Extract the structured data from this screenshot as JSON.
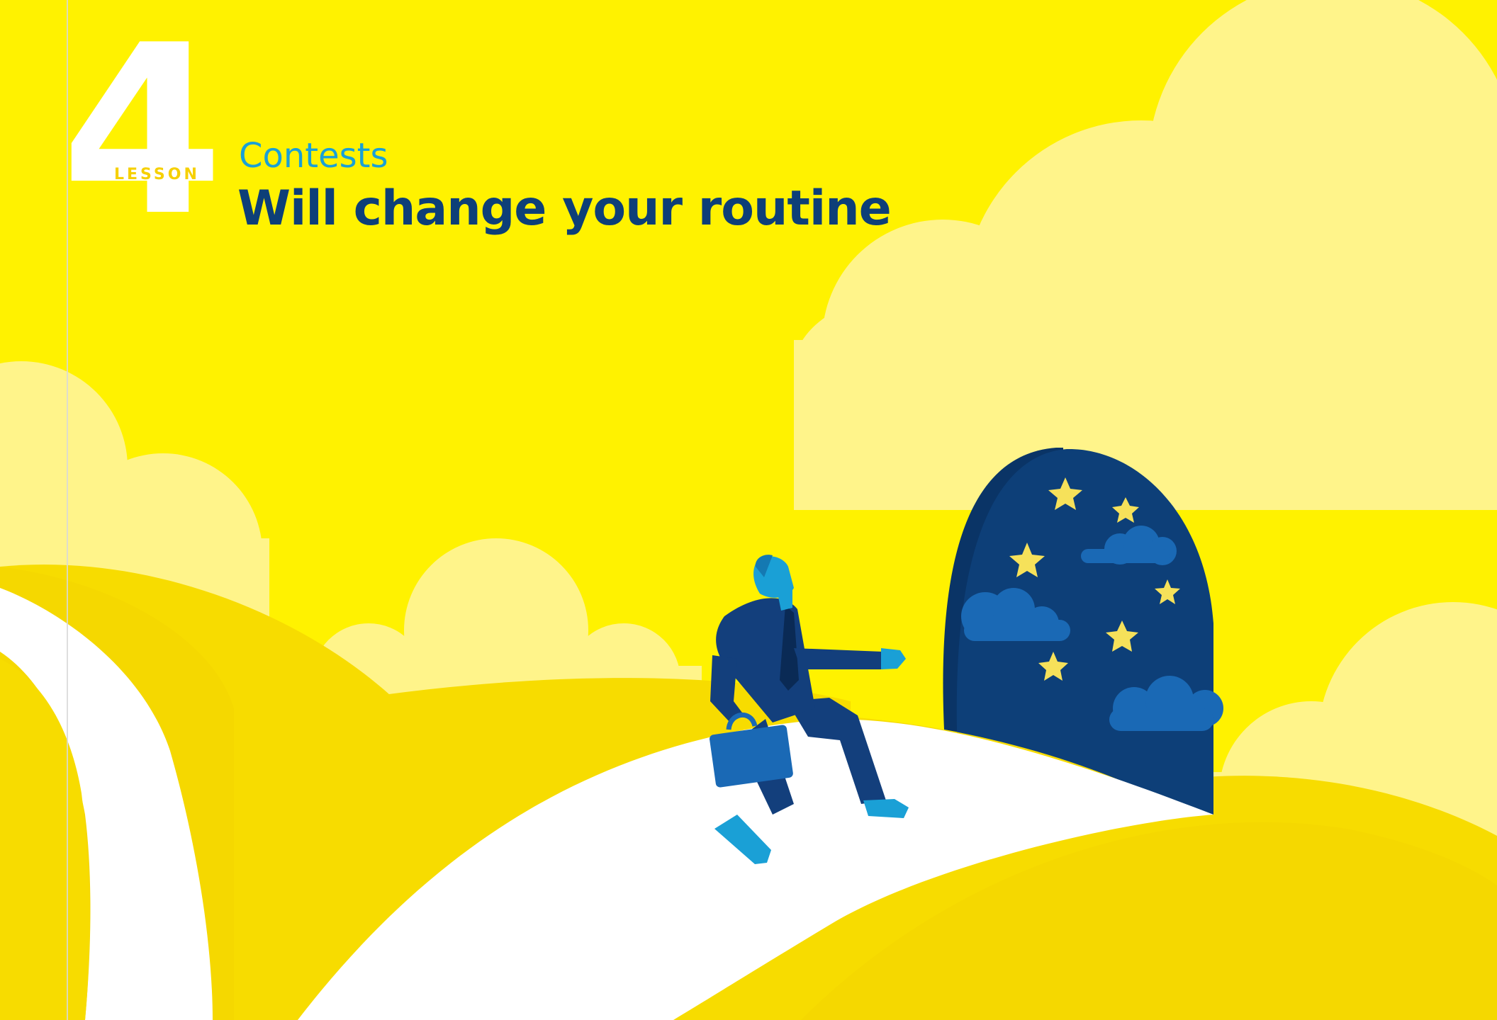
{
  "lesson": {
    "number": "4",
    "label": "LESSON"
  },
  "kicker": "Contests",
  "headline": "Will change your routine",
  "colors": {
    "background": "#fff200",
    "cloud": "#fff48a",
    "hill": "#f7dc00",
    "path": "#ffffff",
    "navy": "#0d3f78",
    "suit": "#133f7c",
    "skin": "#1aa0d6",
    "star": "#f6e15a"
  }
}
